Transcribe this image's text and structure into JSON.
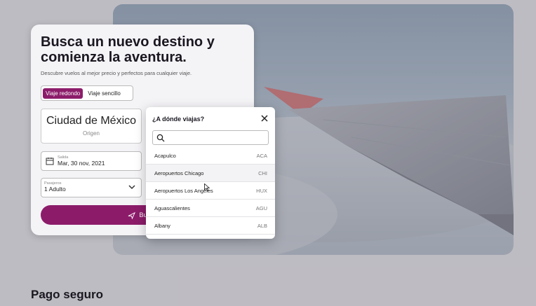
{
  "hero": {
    "headline_line1": "Busca un nuevo destino y",
    "headline_line2": "comienza la aventura.",
    "subtitle": "Descubre vuelos al mejor precio y perfectos para cualquier viaje."
  },
  "trip_type": {
    "round_trip": "Viaje redondo",
    "one_way": "Viaje sencillo",
    "selected": "Viaje redondo"
  },
  "origin": {
    "city": "Ciudad de México",
    "label": "Origen"
  },
  "departure": {
    "label": "Salida",
    "value": "Mar, 30 nov, 2021"
  },
  "passengers": {
    "label": "Pasajeros",
    "value": "1 Adulto"
  },
  "search_button": {
    "label": "Busca"
  },
  "destination_modal": {
    "title": "¿A dónde viajas?",
    "search_value": "",
    "destinations": [
      {
        "name": "Acapulco",
        "code": "ACA"
      },
      {
        "name": "Aeropuertos Chicago",
        "code": "CHI"
      },
      {
        "name": "Aeropuertos Los Angeles",
        "code": "HUX"
      },
      {
        "name": "Aguascalientes",
        "code": "AGU"
      },
      {
        "name": "Albany",
        "code": "ALB"
      }
    ]
  },
  "footer": {
    "section_title": "Pago seguro"
  },
  "colors": {
    "brand": "#8c1c6a",
    "backdrop": "#787480"
  }
}
